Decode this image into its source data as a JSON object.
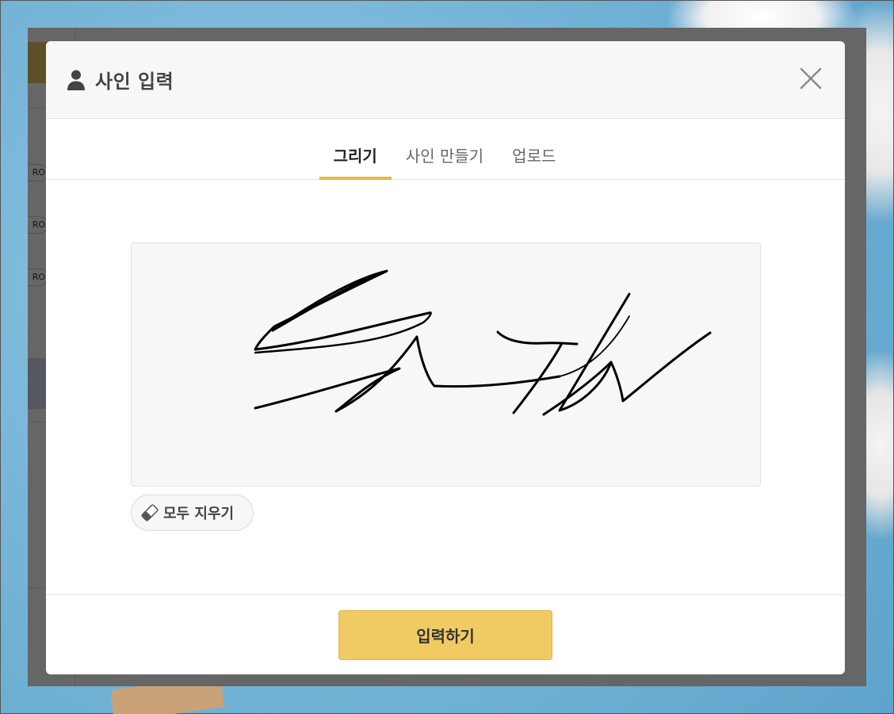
{
  "background": {
    "sidebar_badges": [
      "RO",
      "RO",
      "RO"
    ]
  },
  "modal": {
    "title": "사인 입력",
    "title_icon": "person-icon",
    "close_icon": "close-icon",
    "tabs": [
      {
        "label": "그리기",
        "active": true
      },
      {
        "label": "사인 만들기",
        "active": false
      },
      {
        "label": "업로드",
        "active": false
      }
    ],
    "clear_button": {
      "label": "모두 지우기",
      "icon": "eraser-icon"
    },
    "submit_button": {
      "label": "입력하기"
    }
  },
  "colors": {
    "accent": "#e8b93e",
    "submit_bg": "#f0ca63",
    "canvas_bg": "#f7f7f7",
    "header_bg": "#f7f7f7"
  }
}
